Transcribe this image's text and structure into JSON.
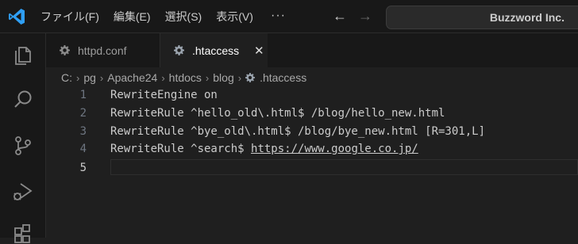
{
  "menu": [
    "ファイル(F)",
    "編集(E)",
    "選択(S)",
    "表示(V)"
  ],
  "more_label": "···",
  "search_box": {
    "text": "Buzzword Inc."
  },
  "tabs": [
    {
      "label": "httpd.conf",
      "active": false
    },
    {
      "label": ".htaccess",
      "active": true
    }
  ],
  "tab_close": "✕",
  "breadcrumb": [
    "C:",
    "pg",
    "Apache24",
    "htdocs",
    "blog",
    ".htaccess"
  ],
  "breadcrumb_sep": "›",
  "editor": {
    "line_numbers": [
      "1",
      "2",
      "3",
      "4",
      "5"
    ],
    "lines": [
      "RewriteEngine on",
      "RewriteRule ^hello_old\\.html$ /blog/hello_new.html",
      "RewriteRule ^bye_old\\.html$ /blog/bye_new.html [R=301,L]",
      "RewriteRule ^search$ ",
      ""
    ],
    "link_text": "https://www.google.co.jp/"
  },
  "colors": {
    "accent": "#0078d4",
    "background": "#1f1f1f"
  }
}
